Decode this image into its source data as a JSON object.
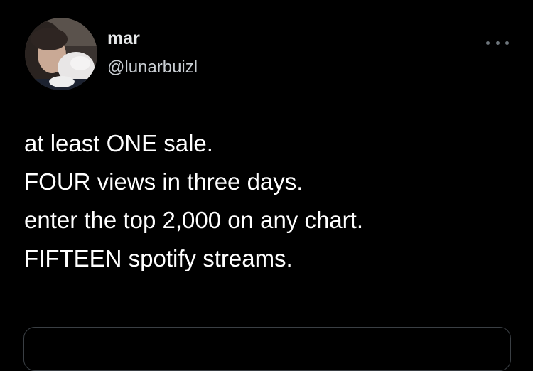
{
  "tweet": {
    "author": {
      "display_name": "mar",
      "handle": "@lunarbuizl",
      "avatar_icon": "profile-photo"
    },
    "more_icon": "ellipsis-icon",
    "lines": [
      "at least ONE sale.",
      "FOUR views in three days.",
      "enter the top 2,000 on any chart.",
      "FIFTEEN spotify streams."
    ]
  },
  "colors": {
    "background": "#000000",
    "text_primary": "#ffffff",
    "text_secondary": "#c9ced3",
    "icon_muted": "#6e767d",
    "border": "#3a3f44"
  }
}
